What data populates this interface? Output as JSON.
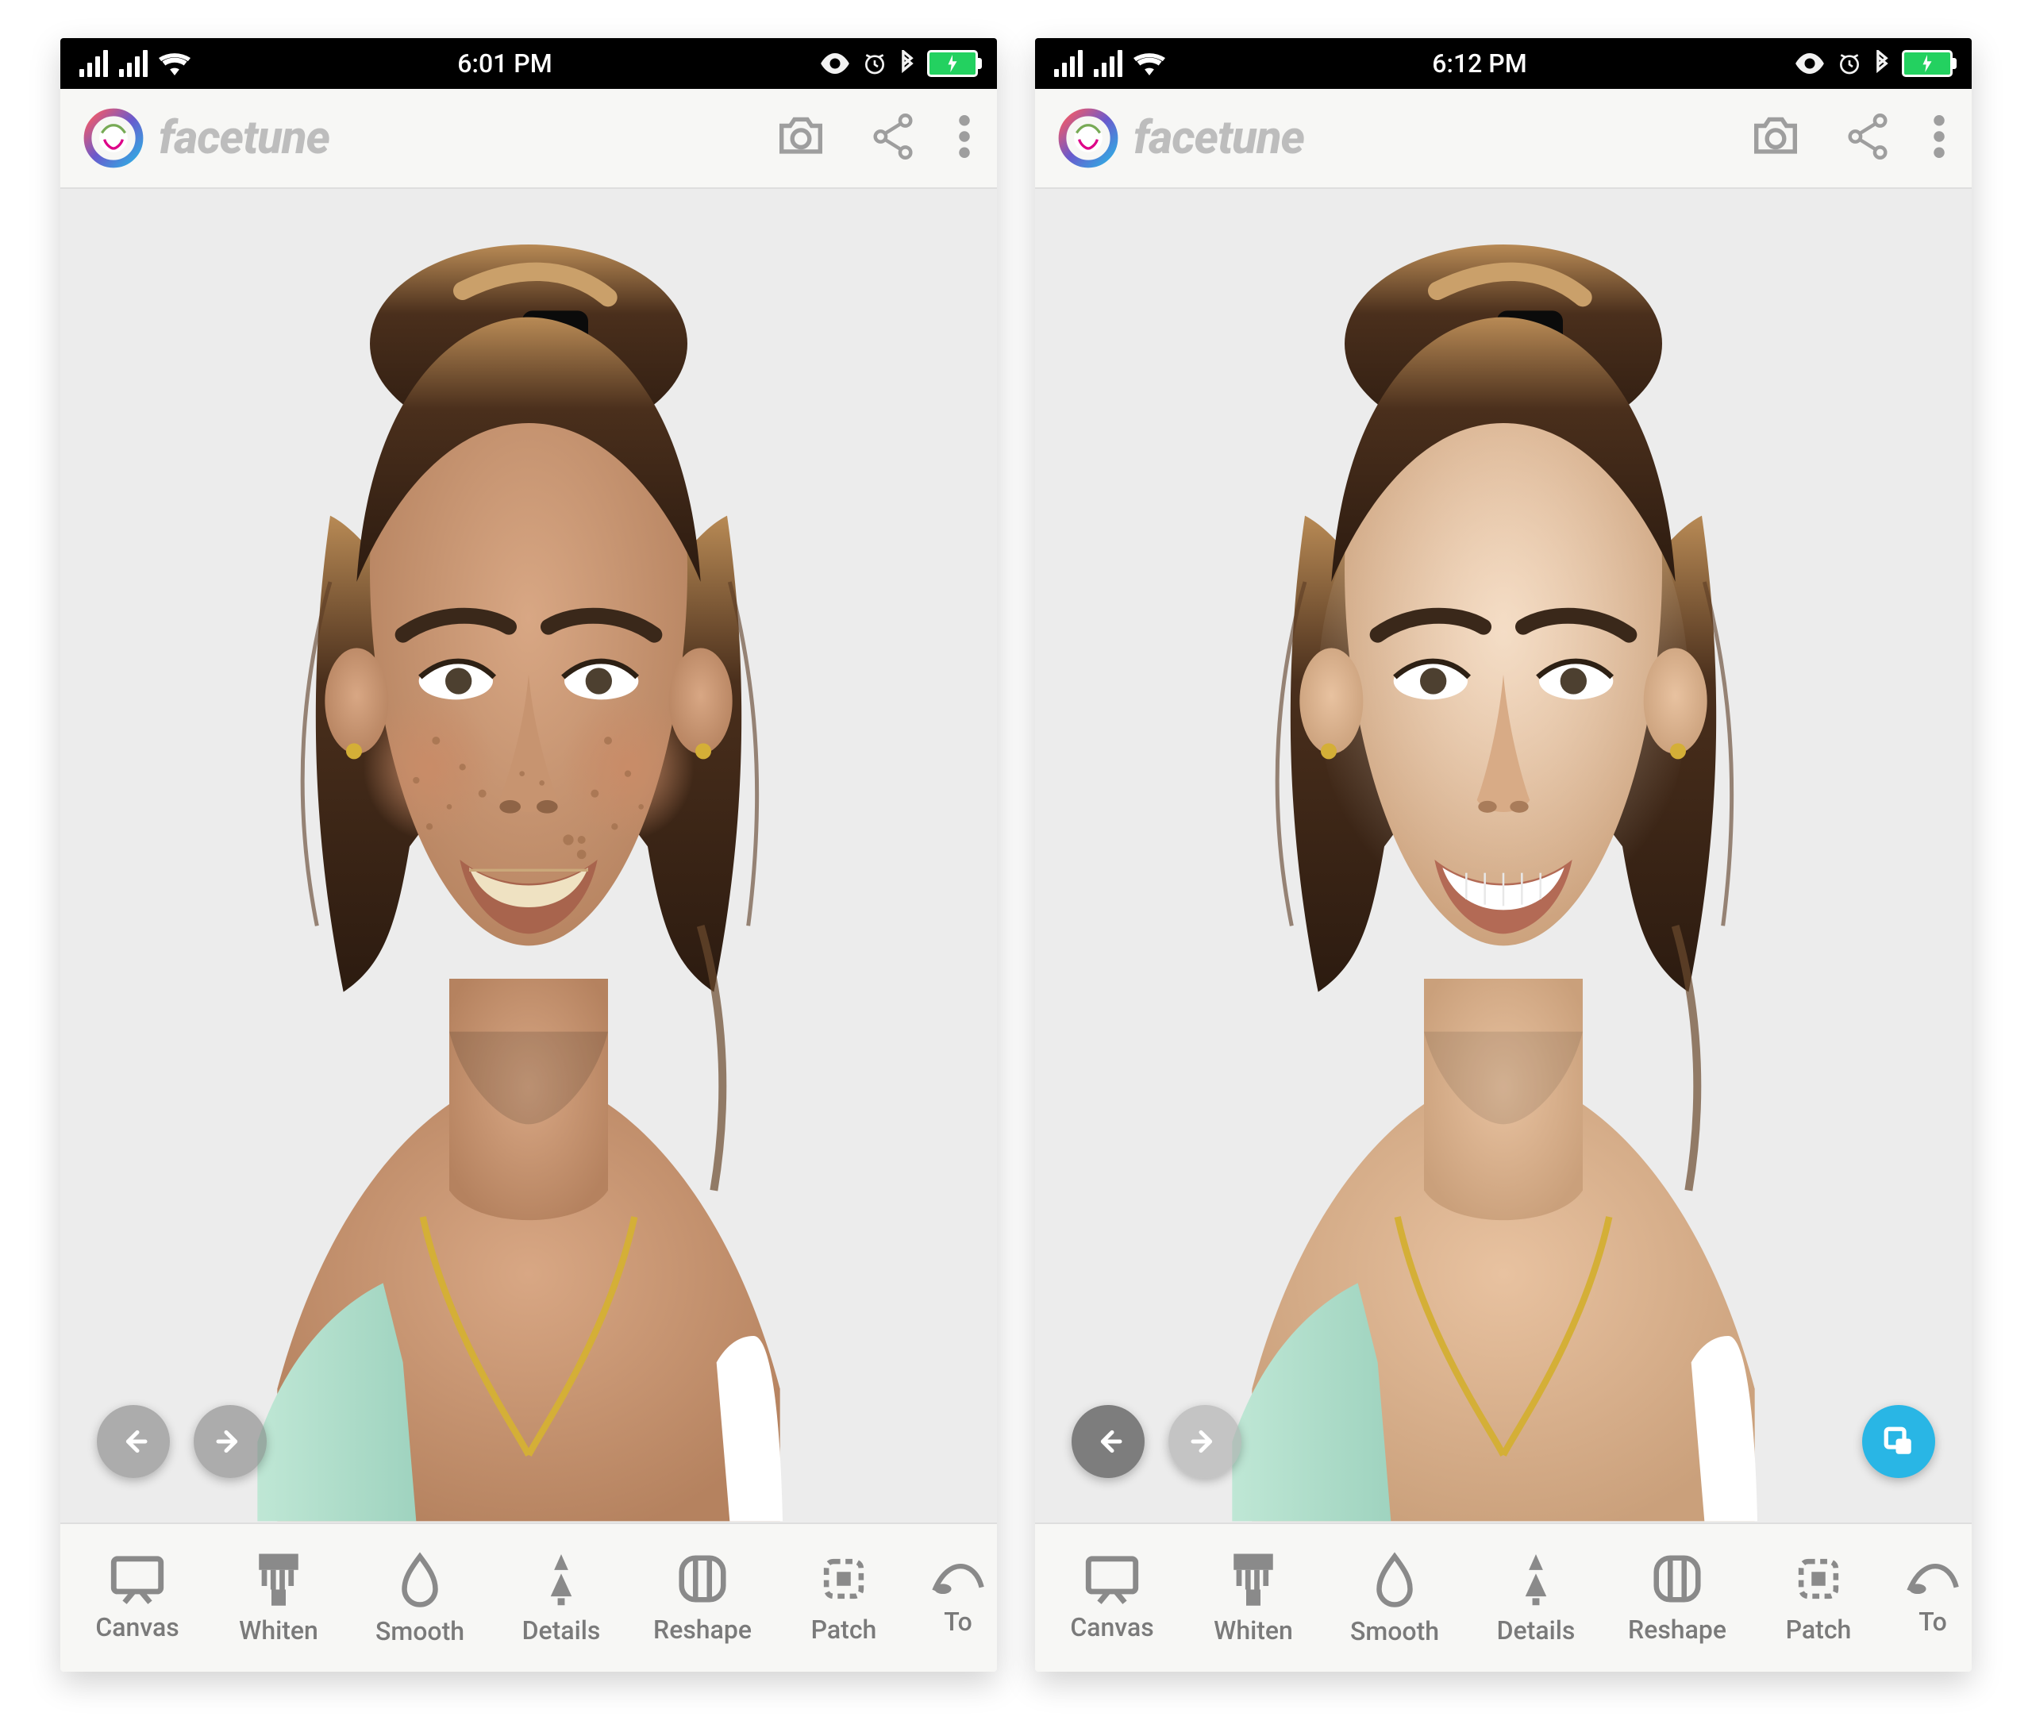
{
  "screens": [
    {
      "statusbar": {
        "time": "6:01 PM"
      }
    },
    {
      "statusbar": {
        "time": "6:12 PM"
      }
    }
  ],
  "app": {
    "brand": "facetune"
  },
  "toolbar": {
    "items": [
      {
        "id": "canvas",
        "label": "Canvas"
      },
      {
        "id": "whiten",
        "label": "Whiten"
      },
      {
        "id": "smooth",
        "label": "Smooth"
      },
      {
        "id": "details",
        "label": "Details"
      },
      {
        "id": "reshape",
        "label": "Reshape"
      },
      {
        "id": "patch",
        "label": "Patch"
      },
      {
        "id": "tones",
        "label": "To"
      }
    ]
  },
  "colors": {
    "accent": "#29b6e5",
    "battery": "#23d160"
  }
}
